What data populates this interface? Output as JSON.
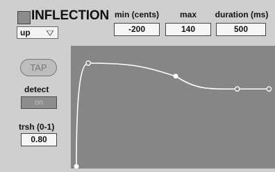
{
  "title": "INFLECTION",
  "direction": {
    "selected": "up"
  },
  "params": {
    "min": {
      "label": "min (cents)",
      "value": "-200"
    },
    "max": {
      "label": "max",
      "value": "140"
    },
    "duration": {
      "label": "duration (ms)",
      "value": "500"
    }
  },
  "controls": {
    "tap_label": "TAP",
    "detect_label": "detect",
    "detect_value": "on",
    "threshold_label": "trsh (0-1)",
    "threshold_value": "0.80"
  },
  "colors": {
    "background": "#cfcfcf",
    "plot_background": "#868686",
    "curve": "#ffffff",
    "swatch": "#8c8c8c"
  },
  "curve": {
    "breakpoints": [
      {
        "t": 0.0,
        "v": -200
      },
      {
        "t": 0.06,
        "v": 140
      },
      {
        "t": 0.5,
        "v": 97
      },
      {
        "t": 0.81,
        "v": 55
      },
      {
        "t": 0.97,
        "v": 55
      }
    ]
  }
}
